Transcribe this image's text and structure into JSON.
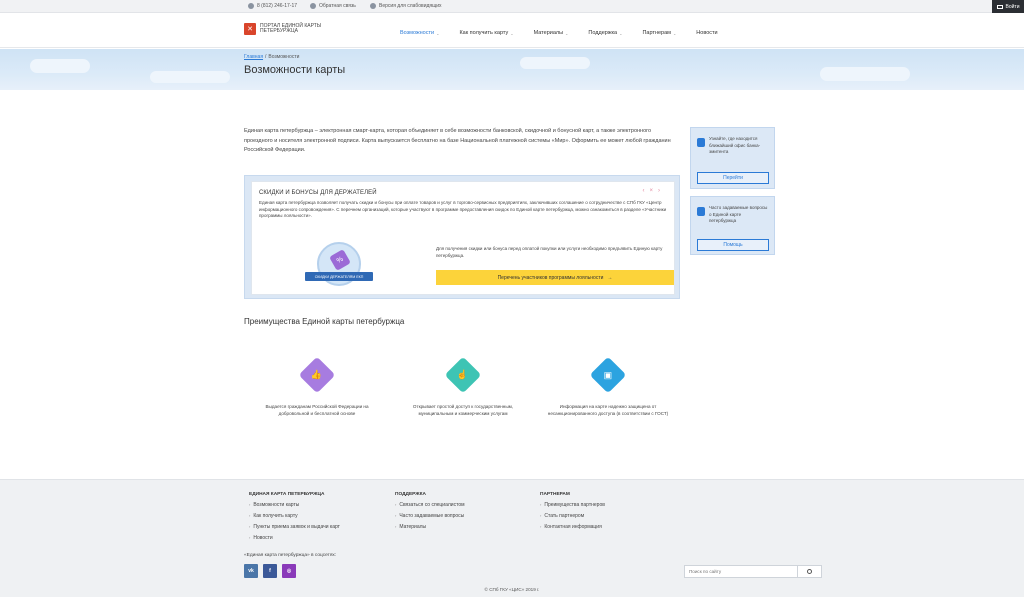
{
  "topbar": {
    "phone": "8 (812) 246-17-17",
    "feedback": "Обратная связь",
    "accessible": "Версия для слабовидящих",
    "login": "Войти"
  },
  "header": {
    "logo_text": "ПОРТАЛ ЕДИНОЙ КАРТЫ ПЕТЕРБУРЖЦА",
    "nav": [
      {
        "label": "Возможности",
        "active": true,
        "has_dropdown": true
      },
      {
        "label": "Как получить карту",
        "active": false,
        "has_dropdown": true
      },
      {
        "label": "Материалы",
        "active": false,
        "has_dropdown": true
      },
      {
        "label": "Поддержка",
        "active": false,
        "has_dropdown": true
      },
      {
        "label": "Партнерам",
        "active": false,
        "has_dropdown": true
      },
      {
        "label": "Новости",
        "active": false,
        "has_dropdown": false
      }
    ]
  },
  "hero": {
    "breadcrumb": [
      "Главная",
      "Возможности"
    ],
    "title": "Возможности карты"
  },
  "intro": "Единая карта петербуржца – электронная смарт-карта, которая объединяет в себе возможности банковской, скидочной и бонусной карт, а также электронного проездного и носителя электронной подписи. Карта выпускается бесплатно на базе Национальной платежной системы «Мир». Оформить ее может любой гражданин Российской Федерации.",
  "sidebar": [
    {
      "text": "Узнайте, где находится ближайший офис банка-эмитента",
      "button": "Перейти",
      "icon": "map-pin-icon"
    },
    {
      "text": "Часто задаваемые вопросы о Единой карте петербуржца",
      "button": "Помощь",
      "icon": "question-icon"
    }
  ],
  "discounts": {
    "title": "СКИДКИ И БОНУСЫ ДЛЯ ДЕРЖАТЕЛЕЙ",
    "text": "Единая карта петербуржца позволяет получать скидки и бонусы при оплате товаров и услуг в торгово-сервисных предприятиях, заключивших соглашение о сотрудничестве с СПб ГКУ «Центр информационного сопровождения». С перечнем организаций, которые участвуют в программе предоставления скидок по Единой карте петербуржца, можно ознакомиться в разделе «Участники программы лояльности».",
    "badge_label": "СКИДКИ ДЕРЖАТЕЛЯМ ЕКП",
    "right_text": "Для получения скидки или бонуса перед оплатой покупки или услуги необходимо предъявить Единую карту петербуржца.",
    "button": "Перечень участников программы лояльности"
  },
  "advantages": {
    "title": "Преимущества Единой карты петербуржца",
    "items": [
      {
        "text": "Выдается гражданам Российской Федерации на добровольной и бесплатной основе",
        "color": "#a77ce0",
        "icon": "thumbs-up-icon"
      },
      {
        "text": "Открывает простой доступ к государственным, муниципальным и коммерческим услугам",
        "color": "#3ec4b4",
        "icon": "hand-pointer-icon"
      },
      {
        "text": "Информация на карте надежно защищена от несанкционированного доступа (в соответствии с ГОСТ)",
        "color": "#2ca3e0",
        "icon": "shield-card-icon"
      }
    ]
  },
  "footer": {
    "columns": [
      {
        "heading": "ЕДИНАЯ КАРТА ПЕТЕРБУРЖЦА",
        "links": [
          "Возможности карты",
          "Как получить карту",
          "Пункты приема заявок и выдачи карт",
          "Новости"
        ]
      },
      {
        "heading": "ПОДДЕРЖКА",
        "links": [
          "Связаться со специалистом",
          "Часто задаваемые вопросы",
          "Материалы"
        ]
      },
      {
        "heading": "ПАРТНЕРАМ",
        "links": [
          "Преимущества партнеров",
          "Стать партнером",
          "Контактная информация"
        ]
      }
    ],
    "social_title": "«Единая карта петербуржца» в соцсетях:",
    "socials": [
      {
        "label": "vk",
        "color": "#4a76a8"
      },
      {
        "label": "f",
        "color": "#3b5998"
      },
      {
        "label": "ig",
        "color": "#8a3ab9"
      }
    ],
    "search_placeholder": "Поиск по сайту",
    "copyright": "© СПб ГКУ «ЦИС» 2019 г."
  },
  "colors": {
    "accent": "#2b7ad6",
    "yellow": "#fcd33a"
  }
}
